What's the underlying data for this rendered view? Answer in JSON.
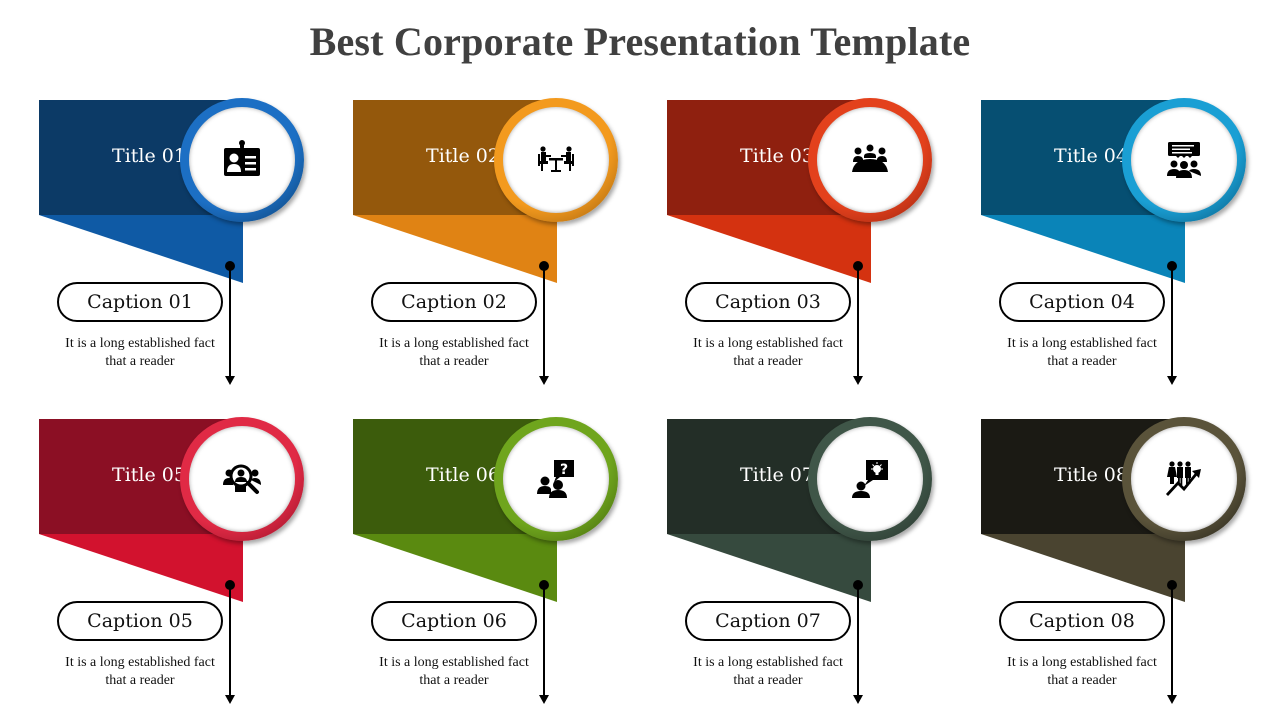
{
  "title": "Best Corporate Presentation Template",
  "cards": [
    {
      "title": "Title 01",
      "caption": "Caption 01",
      "desc_line1": "It is a long established  fact",
      "desc_line2": "that a reader",
      "icon": "id-badge-icon",
      "band": "#0c3a66",
      "tri": "#0f5aa5",
      "ring": "#1c6fc4"
    },
    {
      "title": "Title 02",
      "caption": "Caption 02",
      "desc_line1": "It is a long established  fact",
      "desc_line2": "that a reader",
      "icon": "meeting-table-icon",
      "band": "#94580c",
      "tri": "#e08314",
      "ring": "#f39a1e"
    },
    {
      "title": "Title 03",
      "caption": "Caption 03",
      "desc_line1": "It is a long established  fact",
      "desc_line2": "that a reader",
      "icon": "team-conference-icon",
      "band": "#8f200f",
      "tri": "#d43210",
      "ring": "#e3411c"
    },
    {
      "title": "Title 04",
      "caption": "Caption 04",
      "desc_line1": "It is a long established  fact",
      "desc_line2": "that a reader",
      "icon": "group-discussion-icon",
      "band": "#064f72",
      "tri": "#0a84b8",
      "ring": "#1a9fd4"
    },
    {
      "title": "Title 05",
      "caption": "Caption 05",
      "desc_line1": "It is a long established  fact",
      "desc_line2": "that a reader",
      "icon": "talent-search-icon",
      "band": "#8b0f24",
      "tri": "#d2122e",
      "ring": "#e02a45"
    },
    {
      "title": "Title 06",
      "caption": "Caption 06",
      "desc_line1": "It is a long established  fact",
      "desc_line2": "that a reader",
      "icon": "question-chat-icon",
      "band": "#3c5c0c",
      "tri": "#5a8a10",
      "ring": "#6fa51d"
    },
    {
      "title": "Title 07",
      "caption": "Caption 07",
      "desc_line1": "It is a long established  fact",
      "desc_line2": "that a reader",
      "icon": "idea-person-icon",
      "band": "#232e27",
      "tri": "#364a3e",
      "ring": "#3f5648"
    },
    {
      "title": "Title 08",
      "caption": "Caption 08",
      "desc_line1": "It is a long established  fact",
      "desc_line2": "that a reader",
      "icon": "team-growth-icon",
      "band": "#1b1a14",
      "tri": "#4a4430",
      "ring": "#5a533a"
    }
  ]
}
